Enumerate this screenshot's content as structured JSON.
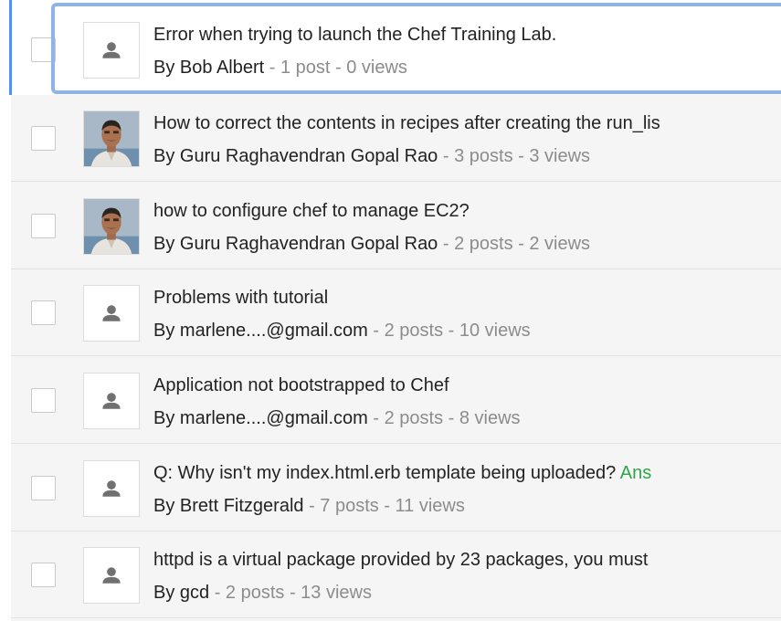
{
  "topics": [
    {
      "title": "Error when trying to launch the Chef Training Lab.",
      "author": "Bob Albert",
      "stats": " - 1 post - 0 views",
      "avatar": "default-avatar",
      "badge": ""
    },
    {
      "title": "How to correct the contents in recipes after creating the run_lis",
      "author": "Guru Raghavendran Gopal Rao",
      "stats": " - 3 posts - 3 views",
      "avatar": "user-photo",
      "badge": ""
    },
    {
      "title": "how to configure chef to manage EC2?",
      "author": "Guru Raghavendran Gopal Rao",
      "stats": " - 2 posts - 2 views",
      "avatar": "user-photo",
      "badge": ""
    },
    {
      "title": "Problems with tutorial",
      "author": "marlene....@gmail.com",
      "stats": " - 2 posts - 10 views",
      "avatar": "default-avatar",
      "badge": ""
    },
    {
      "title": "Application not bootstrapped to Chef",
      "author": "marlene....@gmail.com",
      "stats": " - 2 posts - 8 views",
      "avatar": "default-avatar",
      "badge": ""
    },
    {
      "title": "Q: Why isn't my index.html.erb template being uploaded? ",
      "author": "Brett Fitzgerald",
      "stats": " - 7 posts - 11 views",
      "avatar": "default-avatar",
      "badge": "Ans"
    },
    {
      "title": "httpd is a virtual package provided by 23 packages, you must",
      "author": "gcd",
      "stats": " - 2 posts - 13 views",
      "avatar": "default-avatar",
      "badge": ""
    }
  ],
  "labels": {
    "by": "By "
  },
  "colors": {
    "focus": "#8fb4ec",
    "indicator": "#4d90fe",
    "answer": "#2fa54a",
    "stats": "#8c8c8c"
  }
}
